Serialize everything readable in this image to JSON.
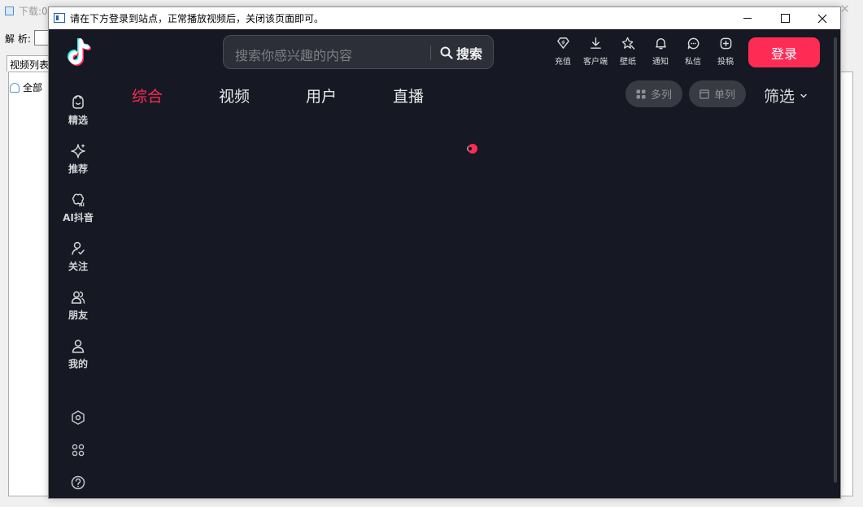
{
  "background_app": {
    "title": "下载:0",
    "parse_label": "解 析:",
    "tab_label": "视频列表",
    "tree_item": "全部"
  },
  "modal": {
    "title": "请在下方登录到站点，正常播放视频后，关闭该页面即可。"
  },
  "page": {
    "search": {
      "placeholder": "搜索你感兴趣的内容",
      "button": "搜索"
    },
    "top_icons": [
      {
        "label": "充值",
        "icon": "diamond-icon"
      },
      {
        "label": "客户端",
        "icon": "download-icon"
      },
      {
        "label": "壁纸",
        "icon": "wallpaper-icon"
      },
      {
        "label": "通知",
        "icon": "bell-icon"
      },
      {
        "label": "私信",
        "icon": "message-icon"
      },
      {
        "label": "投稿",
        "icon": "upload-icon"
      }
    ],
    "login_button": "登录",
    "sidebar": [
      {
        "label": "精选",
        "icon": "featured-icon"
      },
      {
        "label": "推荐",
        "icon": "sparkle-icon"
      },
      {
        "label": "AI抖音",
        "icon": "ai-icon"
      },
      {
        "label": "关注",
        "icon": "follow-icon"
      },
      {
        "label": "朋友",
        "icon": "friends-icon"
      },
      {
        "label": "我的",
        "icon": "profile-icon"
      }
    ],
    "tabs": [
      {
        "label": "综合",
        "active": true
      },
      {
        "label": "视频",
        "active": false
      },
      {
        "label": "用户",
        "active": false
      },
      {
        "label": "直播",
        "active": false
      }
    ],
    "view_toggles": {
      "multi": "多列",
      "single": "单列"
    },
    "filter_label": "筛选"
  },
  "colors": {
    "accent": "#fe2c55",
    "page_bg": "#161823",
    "loader_cyan": "#25f4ee"
  }
}
